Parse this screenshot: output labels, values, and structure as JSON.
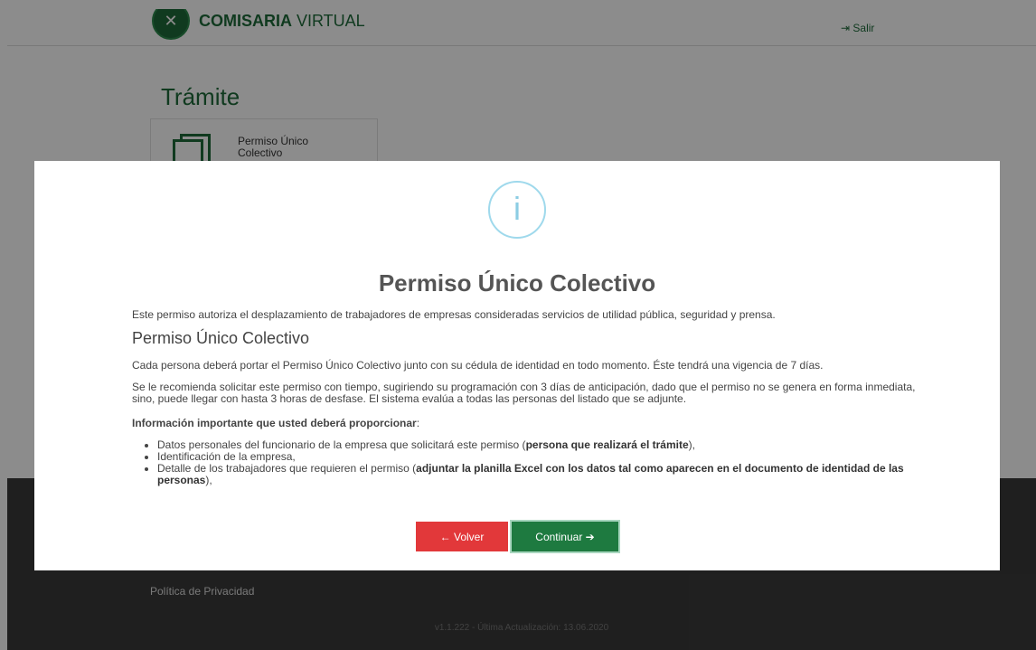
{
  "header": {
    "brand_bold": "COMISARIA",
    "brand_rest": " VIRTUAL",
    "logout_label": "Salir"
  },
  "page": {
    "title": "Trámite",
    "card_label": "Permiso Único Colectivo"
  },
  "footer": {
    "privacy_link": "Política de Privacidad",
    "version": "v1.1.222 - Última Actualización: 13.06.2020"
  },
  "modal": {
    "icon_glyph": "i",
    "title": "Permiso Único Colectivo",
    "intro": "Este permiso autoriza el desplazamiento de trabajadores de empresas consideradas servicios de utilidad pública, seguridad y prensa.",
    "sub_heading": "Permiso Único Colectivo",
    "paragraph1": "Cada persona deberá portar el Permiso Único Colectivo junto con su cédula de identidad en todo momento. Éste tendrá una vigencia de 7 días.",
    "paragraph2": "Se le recomienda solicitar este permiso con tiempo, sugiriendo su programación con 3 días de anticipación, dado que el permiso no se genera en forma inmediata, sino, puede llegar con hasta 3 horas de desfase. El sistema evalúa a todas las personas del listado que se adjunte.",
    "important_label": "Información importante que usted deberá proporcionar",
    "important_suffix": ":",
    "list": [
      {
        "text": "Datos personales del funcionario de la empresa que solicitará este permiso (",
        "bold": "persona que realizará el trámite",
        "after": "),"
      },
      {
        "text": "Identificación de la empresa,",
        "bold": "",
        "after": ""
      },
      {
        "text": "Detalle de los trabajadores que requieren el permiso (",
        "bold": "adjuntar la planilla Excel con los datos tal como aparecen en el documento de identidad de las personas",
        "after": "),"
      }
    ],
    "back_label": "← Volver",
    "continue_label": "Continuar ➔"
  },
  "colors": {
    "brand_green": "#1e6b3a",
    "back_red": "#e2383a",
    "continue_green": "#1e7a40",
    "info_blue": "#8ccde3"
  }
}
